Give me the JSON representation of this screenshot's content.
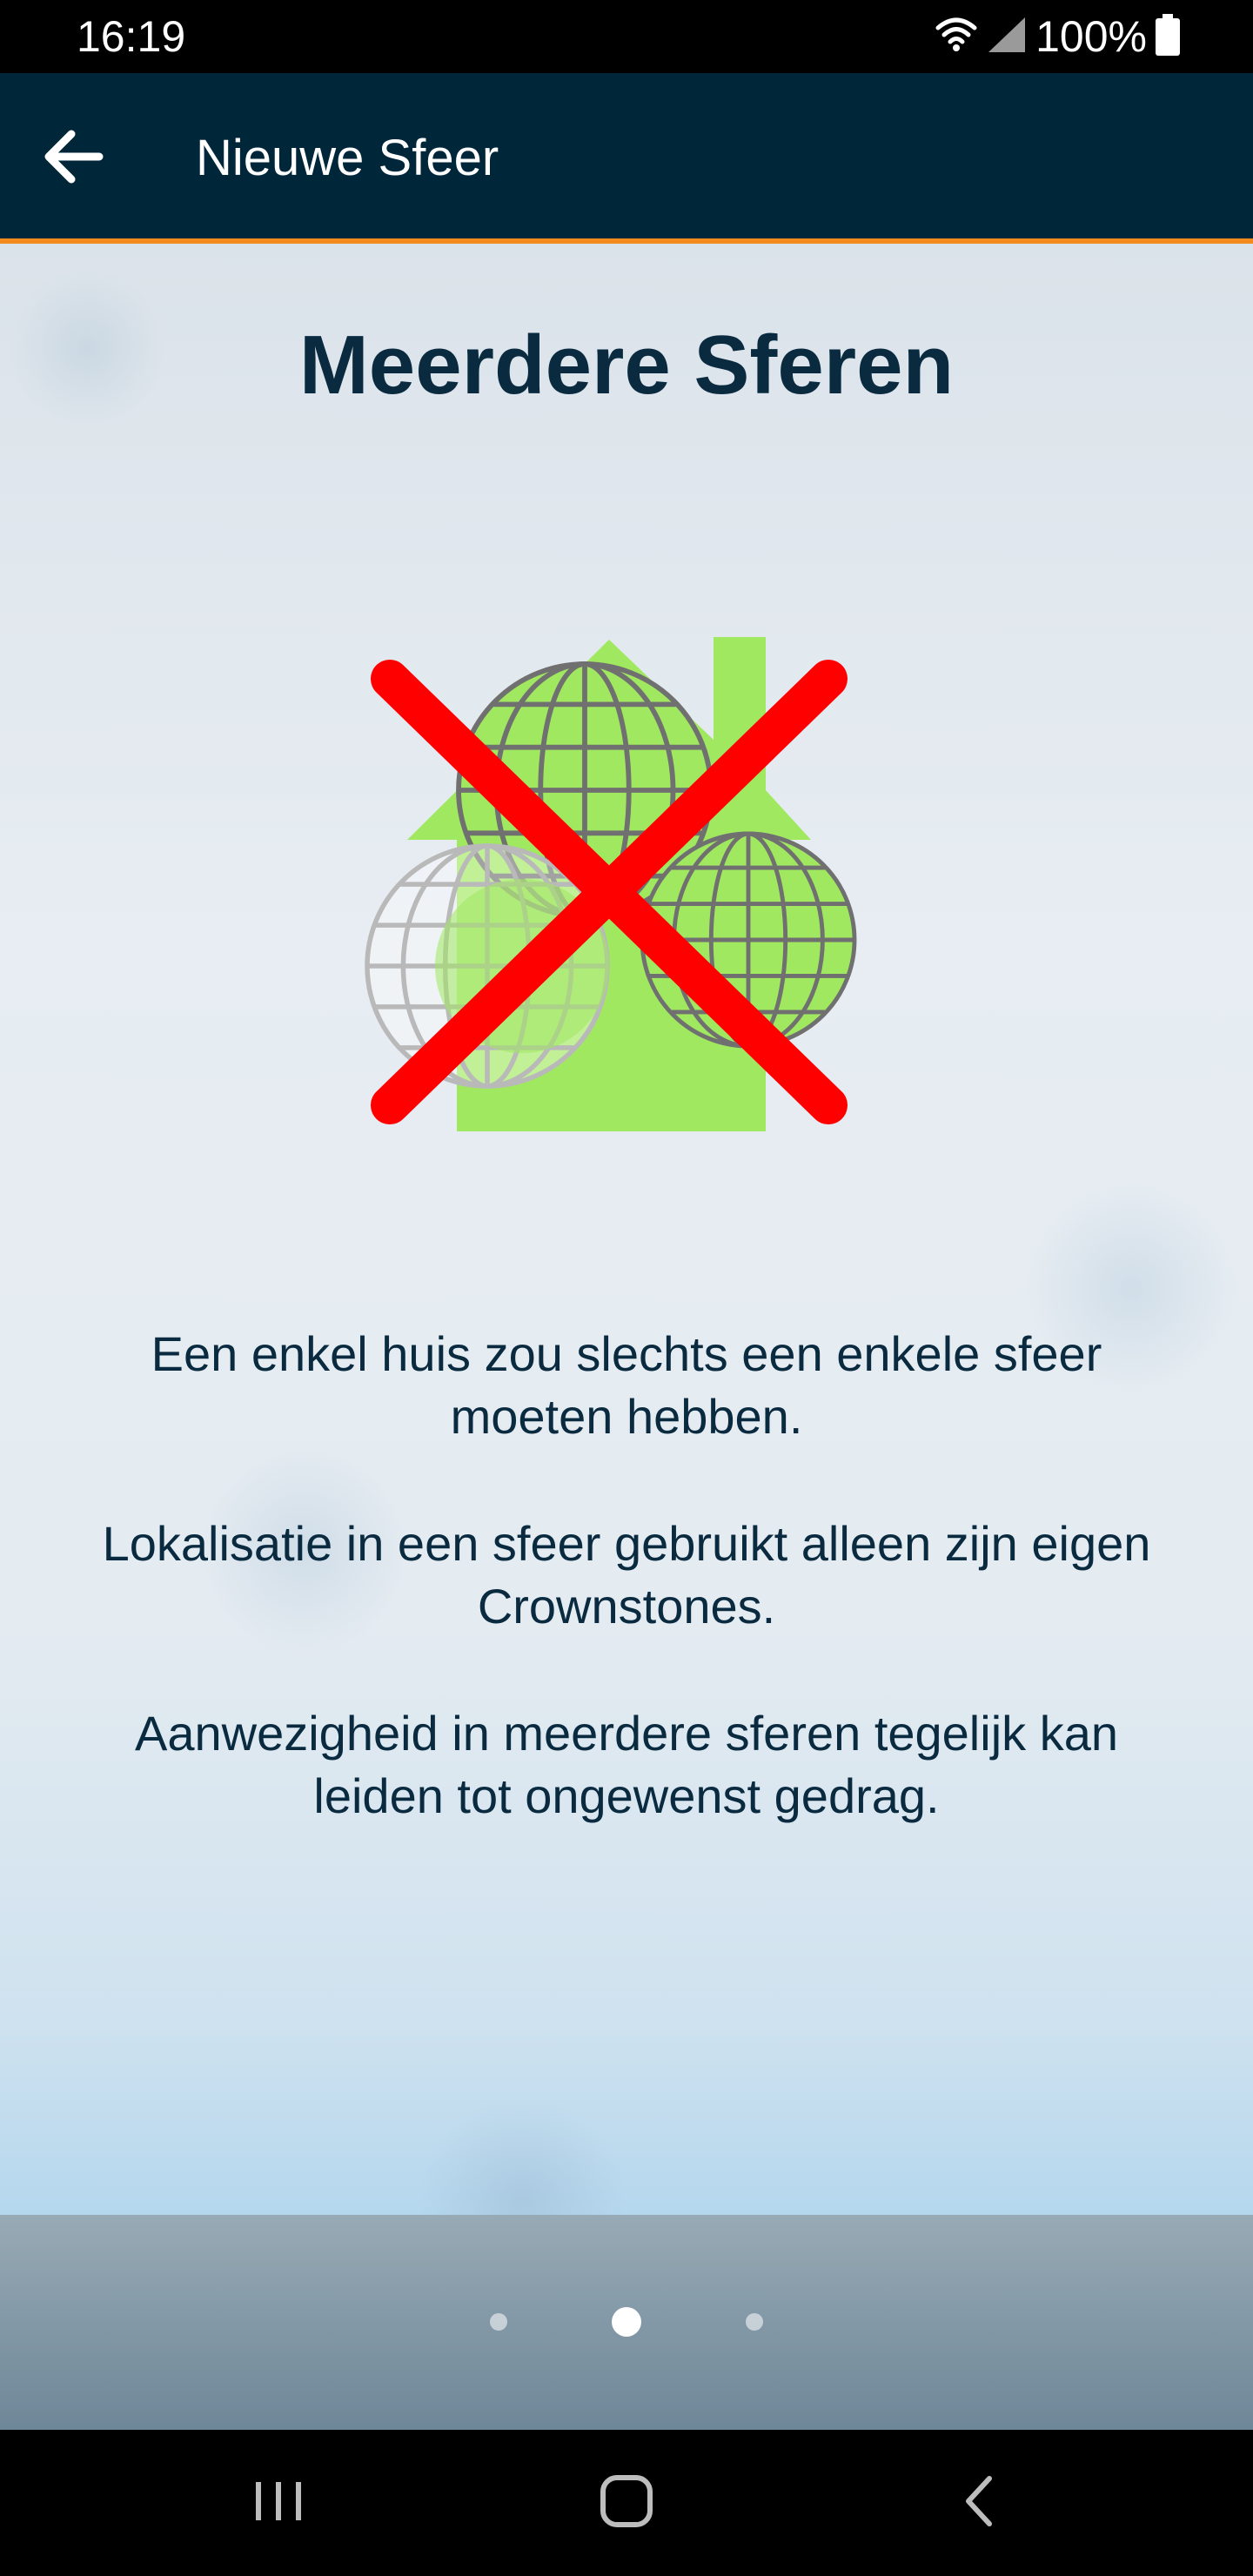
{
  "status_bar": {
    "time": "16:19",
    "battery": "100%",
    "icons": [
      "wifi-icon",
      "signal-icon",
      "battery-icon"
    ]
  },
  "app_bar": {
    "title": "Nieuwe Sfeer",
    "back_icon": "arrow-left-icon",
    "background": "#00263a",
    "accent": "#f28a1e"
  },
  "page": {
    "heading": "Meerdere Sferen",
    "illustration": "multiple-spheres-crossed-out",
    "paragraphs": [
      "Een enkel huis zou slechts een enkele sfeer moeten hebben.",
      "Lokalisatie in een sfeer gebruikt alleen zijn eigen Crownstones.",
      "Aanwezigheid in meerdere sferen tegelijk kan leiden tot ongewenst gedrag."
    ]
  },
  "pager": {
    "total": 3,
    "active_index": 1
  },
  "nav_bar": {
    "buttons": [
      "recents-icon",
      "home-icon",
      "back-icon"
    ]
  },
  "colors": {
    "heading_text": "#0a2a40",
    "house_green": "#a0e860",
    "cross_red": "#ff0000"
  }
}
